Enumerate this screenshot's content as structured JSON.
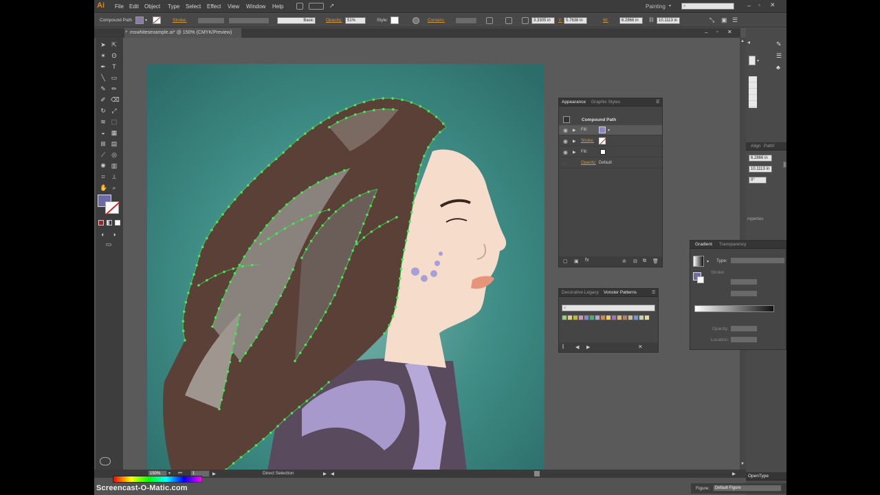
{
  "menubar": {
    "logo": "Ai",
    "menus": [
      "File",
      "Edit",
      "Object",
      "Type",
      "Select",
      "Effect",
      "View",
      "Window",
      "Help"
    ],
    "workspace": "Painting",
    "search_placeholder": ""
  },
  "control_bar": {
    "selection_type": "Compound Path",
    "stroke_label": "Stroke:",
    "brush_value": "Basic",
    "opacity_label": "Opacity:",
    "opacity_value": "51%",
    "style_label": "Style:",
    "x_value": "3.3305 in",
    "y_label": "Y:",
    "y_value": "5.7638 in",
    "w_label": "W:",
    "w_value": "6.2866 in",
    "h_value": "10.1113 in",
    "coord_labels": [
      "Corners:"
    ]
  },
  "document_tab": {
    "name": "mswhitesexample.ai* @ 150% (CMYK/Preview)"
  },
  "appearance_panel": {
    "tabs": [
      "Appearance",
      "Graphic Styles"
    ],
    "title": "Compound Path",
    "rows": [
      {
        "label": "Fill:"
      },
      {
        "label": "Stroke:"
      },
      {
        "label": "Fill:"
      },
      {
        "label": "Opacity:",
        "value": "Default"
      }
    ]
  },
  "swatch_panel": {
    "tabs": [
      "Decorative Legacy",
      "Vonster Patterns"
    ],
    "search_placeholder": ""
  },
  "align_panel": {
    "tabs": [
      "Align",
      "Pathf"
    ],
    "w_value": "6.2866 in",
    "h_value": "10.1113 in",
    "angle_value": "0°",
    "label": "roperties"
  },
  "gradient_panel": {
    "tabs": [
      "Gradient",
      "Transparency"
    ],
    "type_label": "Type:",
    "stroke_label": "Stroke:",
    "opacity_label": "Opacity:",
    "location_label": "Location:"
  },
  "statusbar": {
    "zoom": "150%",
    "artboard": "1",
    "tool": "Direct Selection"
  },
  "opentype_tab": "OpenType",
  "figure": {
    "label": "Figure:",
    "value": "Default Figure"
  },
  "watermark": "Screencast-O-Matic.com",
  "colors": {
    "teal_bg": "#3e8a84",
    "hair": "#5b4038",
    "skin": "#f6dccb",
    "anchor": "#4ee35c",
    "cursor_ring": "#e8e040",
    "accent_orange": "#d89a3a"
  }
}
